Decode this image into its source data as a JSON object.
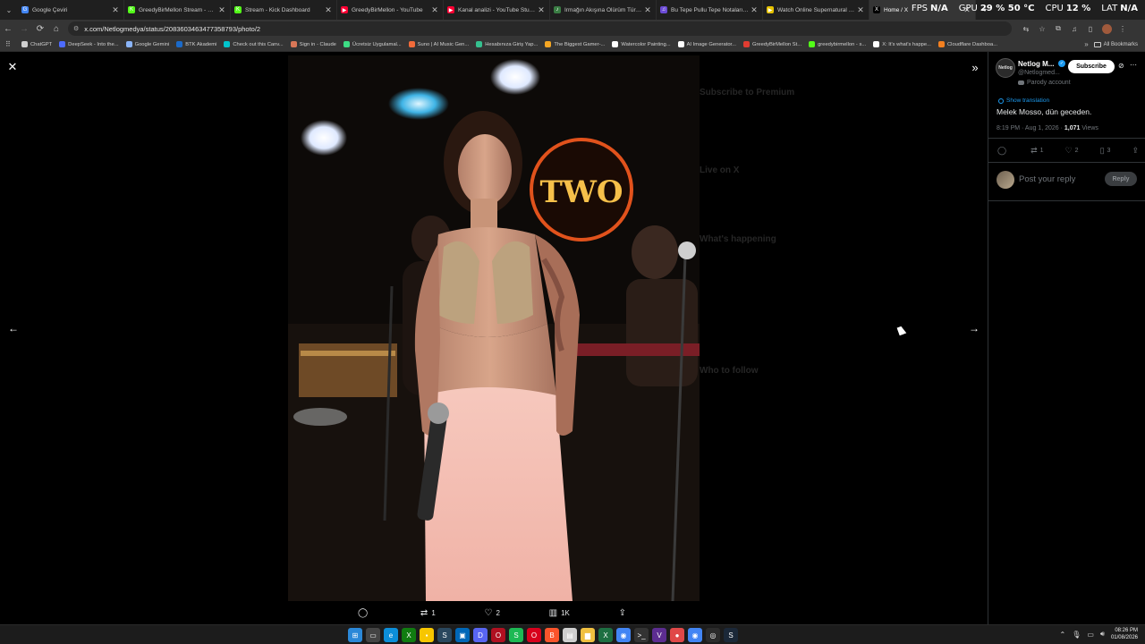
{
  "browser": {
    "tabs": [
      {
        "title": "Google Çeviri",
        "color": "#4285f4",
        "glyph": "G"
      },
      {
        "title": "GreedyBirMellon Stream - Wa...",
        "color": "#53fc18",
        "glyph": "K"
      },
      {
        "title": "Stream - Kick Dashboard",
        "color": "#53fc18",
        "glyph": "K"
      },
      {
        "title": "GreedyBirMellon - YouTube",
        "color": "#ff0033",
        "glyph": "▶"
      },
      {
        "title": "Kanal analizi - YouTube Studio",
        "color": "#ff0033",
        "glyph": "▶"
      },
      {
        "title": "Irmağın Akışına Ölürüm Türk...",
        "color": "#3a7d44",
        "glyph": "♪"
      },
      {
        "title": "Bu Tepe Pullu Tepe Notaları | N...",
        "color": "#6b4bd6",
        "glyph": "♫"
      },
      {
        "title": "Watch Online Supernatural Sea...",
        "color": "#e6c200",
        "glyph": "▶"
      },
      {
        "title": "Home / X",
        "color": "#000000",
        "glyph": "X"
      }
    ],
    "new_tab_glyph": "+",
    "url": "x.com/Netlogmedya/status/2083603463477358793/photo/2",
    "perf": {
      "fps_label": "FPS",
      "fps_value": "N/A",
      "gpu_label": "GPU",
      "gpu_value": "29 % 50 °C",
      "cpu_label": "CPU",
      "cpu_value": "12 %",
      "lat_label": "LAT",
      "lat_value": "N/A"
    },
    "bookmarks": [
      {
        "title": "ChatGPT",
        "color": "#cfcfcf"
      },
      {
        "title": "DeepSeek - Into the...",
        "color": "#4d6bfe"
      },
      {
        "title": "Google Gemini",
        "color": "#8ab4f8"
      },
      {
        "title": "BTK Akademi",
        "color": "#1b6ac9"
      },
      {
        "title": "Check out this Canv...",
        "color": "#00c4cc"
      },
      {
        "title": "Sign in - Claude",
        "color": "#d97757"
      },
      {
        "title": "Ücretsiz Uygulamal...",
        "color": "#3ddc84"
      },
      {
        "title": "Suno | AI Music Gen...",
        "color": "#f26b3a"
      },
      {
        "title": "Hesabınıza Giriş Yap...",
        "color": "#35c08f"
      },
      {
        "title": "The Biggest Gamer-...",
        "color": "#f5a623"
      },
      {
        "title": "Watercolor Painting...",
        "color": "#ffffff"
      },
      {
        "title": "AI Image Generator...",
        "color": "#ffffff"
      },
      {
        "title": "GreedyBirMellon St...",
        "color": "#e03c31"
      },
      {
        "title": "greedybirmellon - s...",
        "color": "#53fc18"
      },
      {
        "title": "X: It's what's happe...",
        "color": "#ffffff"
      },
      {
        "title": "Cloudflare Dashboa...",
        "color": "#f38020"
      }
    ],
    "all_bookmarks": "All Bookmarks"
  },
  "viewer": {
    "photo_sign": "TWO",
    "actions": {
      "replies": "",
      "reposts": "1",
      "likes": "2",
      "views": "1K"
    }
  },
  "post": {
    "avatar_text": "Netlog",
    "name": "Netlog M...",
    "handle": "@Netlogmed...",
    "subscribe_label": "Subscribe",
    "parody_label": "Parody account",
    "translate_label": "Show translation",
    "text": "Melek Mosso, dün geceden.",
    "meta_time": "8:19 PM · Aug 1, 2026 · ",
    "meta_views": "1,071",
    "meta_views_label": " Views",
    "stats": {
      "replies": "",
      "reposts": "1",
      "likes": "2",
      "bookmarks": "3"
    },
    "reply_placeholder": "Post your reply",
    "reply_button": "Reply"
  },
  "background_ghost": {
    "premium": "Subscribe to Premium",
    "live": "Live on X",
    "happening": "What's happening",
    "follow": "Who to follow"
  },
  "taskbar": {
    "apps": [
      {
        "name": "start",
        "color": "#2b88d8",
        "glyph": "⊞"
      },
      {
        "name": "files",
        "color": "#444",
        "glyph": "▭"
      },
      {
        "name": "edge",
        "color": "#0c8ed9",
        "glyph": "e"
      },
      {
        "name": "xbox",
        "color": "#107c10",
        "glyph": "X"
      },
      {
        "name": "sticky",
        "color": "#f7c600",
        "glyph": "▪"
      },
      {
        "name": "steam",
        "color": "#2a475e",
        "glyph": "S"
      },
      {
        "name": "store",
        "color": "#0067b8",
        "glyph": "▣"
      },
      {
        "name": "discord",
        "color": "#5865f2",
        "glyph": "D"
      },
      {
        "name": "app-red",
        "color": "#b01020",
        "glyph": "O"
      },
      {
        "name": "spotify",
        "color": "#1db954",
        "glyph": "S"
      },
      {
        "name": "opera",
        "color": "#d8001c",
        "glyph": "O"
      },
      {
        "name": "brave",
        "color": "#fb542b",
        "glyph": "B"
      },
      {
        "name": "notepad",
        "color": "#cfcfcf",
        "glyph": "▤"
      },
      {
        "name": "explorer",
        "color": "#f0c040",
        "glyph": "▆"
      },
      {
        "name": "excel",
        "color": "#1d6f42",
        "glyph": "X"
      },
      {
        "name": "chrome",
        "color": "#4285f4",
        "glyph": "◉"
      },
      {
        "name": "terminal",
        "color": "#333",
        "glyph": ">_"
      },
      {
        "name": "vs",
        "color": "#5c2d91",
        "glyph": "V"
      },
      {
        "name": "maps",
        "color": "#e04848",
        "glyph": "●"
      },
      {
        "name": "chrome-2",
        "color": "#4285f4",
        "glyph": "◉"
      },
      {
        "name": "obs",
        "color": "#2b2b2b",
        "glyph": "◎"
      },
      {
        "name": "steam-2",
        "color": "#1b2838",
        "glyph": "S"
      }
    ],
    "time": "08:26 PM",
    "date": "01/08/2026"
  }
}
